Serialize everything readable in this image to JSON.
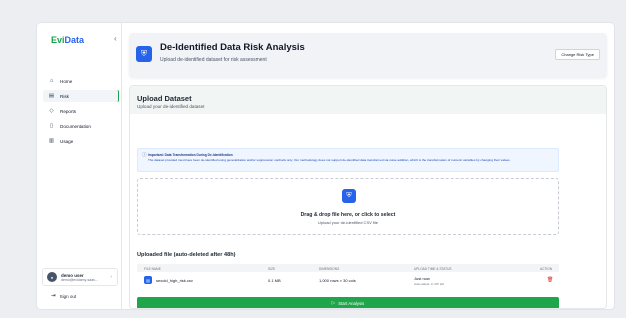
{
  "app": {
    "logo_part1": "Evi",
    "logo_part2": "Data"
  },
  "sidebar": {
    "items": [
      {
        "label": "Home",
        "icon": "home-icon",
        "glyph": "⌂"
      },
      {
        "label": "Risk",
        "icon": "risk-icon",
        "glyph": "▤",
        "active": true
      },
      {
        "label": "Reports",
        "icon": "shield-icon",
        "glyph": "◇"
      },
      {
        "label": "Documentation",
        "icon": "document-icon",
        "glyph": "▯"
      },
      {
        "label": "Usage",
        "icon": "usage-icon",
        "glyph": "▥"
      }
    ],
    "user": {
      "name": "demo user",
      "email": "demo@evidamy-saas...",
      "initials": ""
    },
    "signout_label": "Sign out"
  },
  "header": {
    "title": "De-Identified Data Risk Analysis",
    "subtitle": "Upload de-identified dataset for risk assessment",
    "change_button": "Change Risk Type"
  },
  "upload": {
    "title": "Upload Dataset",
    "subtitle": "Upload your de-identified dataset",
    "notice_title": "Important: Data Transformation During De-Identification",
    "notice_text": "The dataset provided must have been de-identified using generalization and/or suppression methods only. Our methodology does not support de-identified data transformed via noise addition, which is the transformation of numeric variables by changing their values.",
    "drop_title": "Drag & drop file here, or click to select",
    "drop_subtitle": "Upload your de-identified CSV file"
  },
  "files": {
    "title": "Uploaded file (auto-deleted after 48h)",
    "columns": [
      "File name",
      "Size",
      "Dimensions",
      "Upload time & status",
      "Action"
    ],
    "rows": [
      {
        "name": "sexold_high_risk.csv",
        "size": "0.1 MB",
        "dimensions": "1,000 rows × 30 cols",
        "time": "Just now",
        "status": "Auto-delete: in 47h left"
      }
    ]
  },
  "start_button": "Start Analysis",
  "colors": {
    "brand_green": "#1fa54a",
    "brand_blue": "#2563eb",
    "danger": "#dc2626"
  }
}
